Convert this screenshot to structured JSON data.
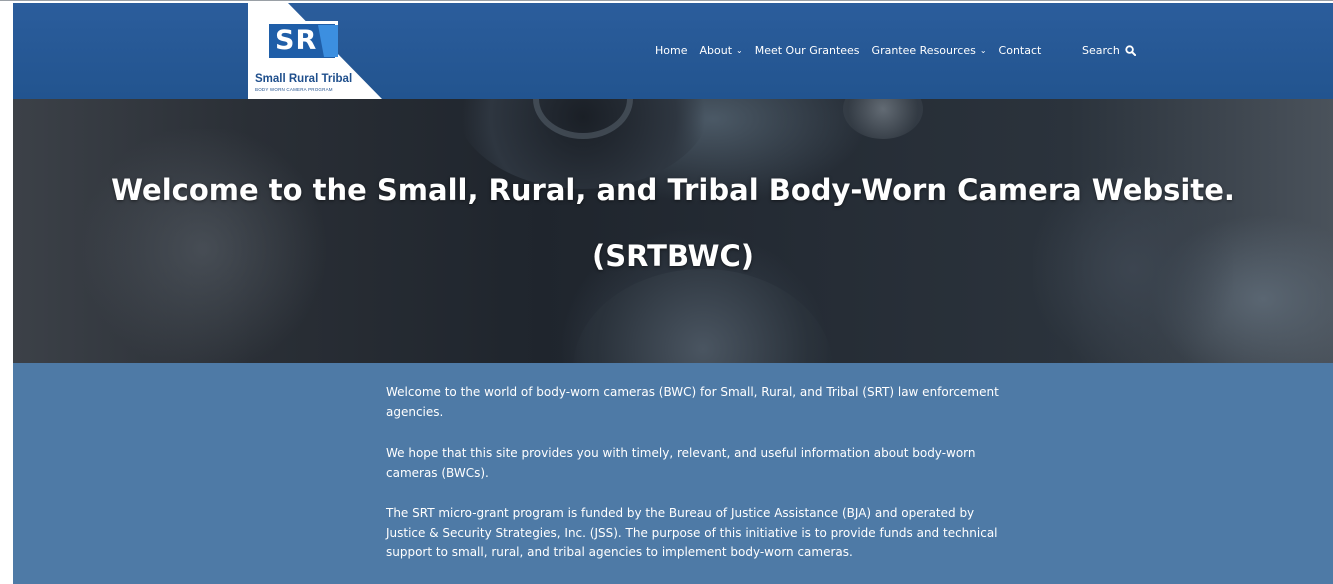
{
  "logo": {
    "mark": "SR",
    "title": "Small Rural Tribal",
    "subtitle": "BODY WORN CAMERA PROGRAM"
  },
  "nav": {
    "items": [
      {
        "label": "Home",
        "has_dropdown": false
      },
      {
        "label": "About",
        "has_dropdown": true
      },
      {
        "label": "Meet Our Grantees",
        "has_dropdown": false
      },
      {
        "label": "Grantee Resources",
        "has_dropdown": true
      },
      {
        "label": "Contact",
        "has_dropdown": false
      }
    ],
    "search_label": "Search",
    "search_icon": "magnifier-icon"
  },
  "hero": {
    "title_line1": "Welcome to the Small, Rural, and Tribal Body-Worn Camera Website.",
    "title_line2": "(SRTBWC)"
  },
  "intro": {
    "paragraphs": [
      "Welcome to the world of body-worn cameras (BWC) for Small, Rural, and Tribal (SRT) law enforcement agencies.",
      "We hope that this site provides you with timely, relevant, and useful information about body-worn cameras (BWCs).",
      "The SRT micro-grant program is funded by the Bureau of Justice Assistance (BJA) and operated by Justice & Security Strategies, Inc. (JSS). The purpose of this initiative is to provide funds and technical support to small, rural, and tribal agencies to implement body-worn cameras."
    ]
  },
  "colors": {
    "header_blue": "#2b5d9c",
    "intro_blue": "#4e7aa6",
    "logo_blue": "#1f5ea8",
    "text_white": "#ffffff"
  }
}
